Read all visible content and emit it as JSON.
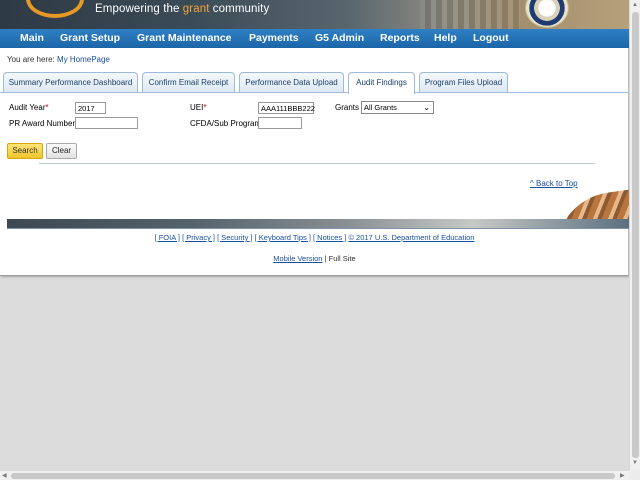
{
  "header": {
    "tagline_pre": "Empowering the ",
    "tagline_hl": "grant",
    "tagline_post": " community"
  },
  "nav": {
    "items": [
      "Main",
      "Grant Setup",
      "Grant Maintenance",
      "Payments",
      "G5 Admin",
      "Reports",
      "Help",
      "Logout"
    ]
  },
  "breadcrumb": {
    "prefix": "You are here: ",
    "link": "My HomePage"
  },
  "tabs": [
    {
      "label": "Summary Performance Dashboard",
      "active": false
    },
    {
      "label": "Confirm Email Receipt",
      "active": false
    },
    {
      "label": "Performance Data Upload",
      "active": false
    },
    {
      "label": "Audit Findings",
      "active": true
    },
    {
      "label": "Program Files Upload",
      "active": false
    }
  ],
  "form": {
    "audit_year_label": "Audit Year",
    "audit_year_value": "2017",
    "uei_label": "UEI",
    "uei_value": "AAA111BBB222",
    "grants_label": "Grants",
    "grants_value": "All Grants",
    "pr_award_label": "PR Award Number",
    "pr_award_value": "",
    "cfda_label": "CFDA/Sub Program",
    "cfda_value": "",
    "required_mark": "*",
    "search_label": "Search",
    "clear_label": "Clear"
  },
  "back_to_top": "^ Back to Top",
  "footer": {
    "links": [
      "[ FOIA ]",
      "[ Privacy ]",
      "[ Security ]",
      "[ Keyboard Tips ]",
      "[ Notices ]",
      "© 2017 U.S. Department of Education"
    ],
    "mobile_version": "Mobile Version",
    "separator": " | ",
    "full_site": "Full Site"
  },
  "colors": {
    "nav_bg": "#1c66a8",
    "accent_orange": "#f2a43b",
    "search_button": "#f2c52b",
    "link": "#1a4fa0"
  }
}
